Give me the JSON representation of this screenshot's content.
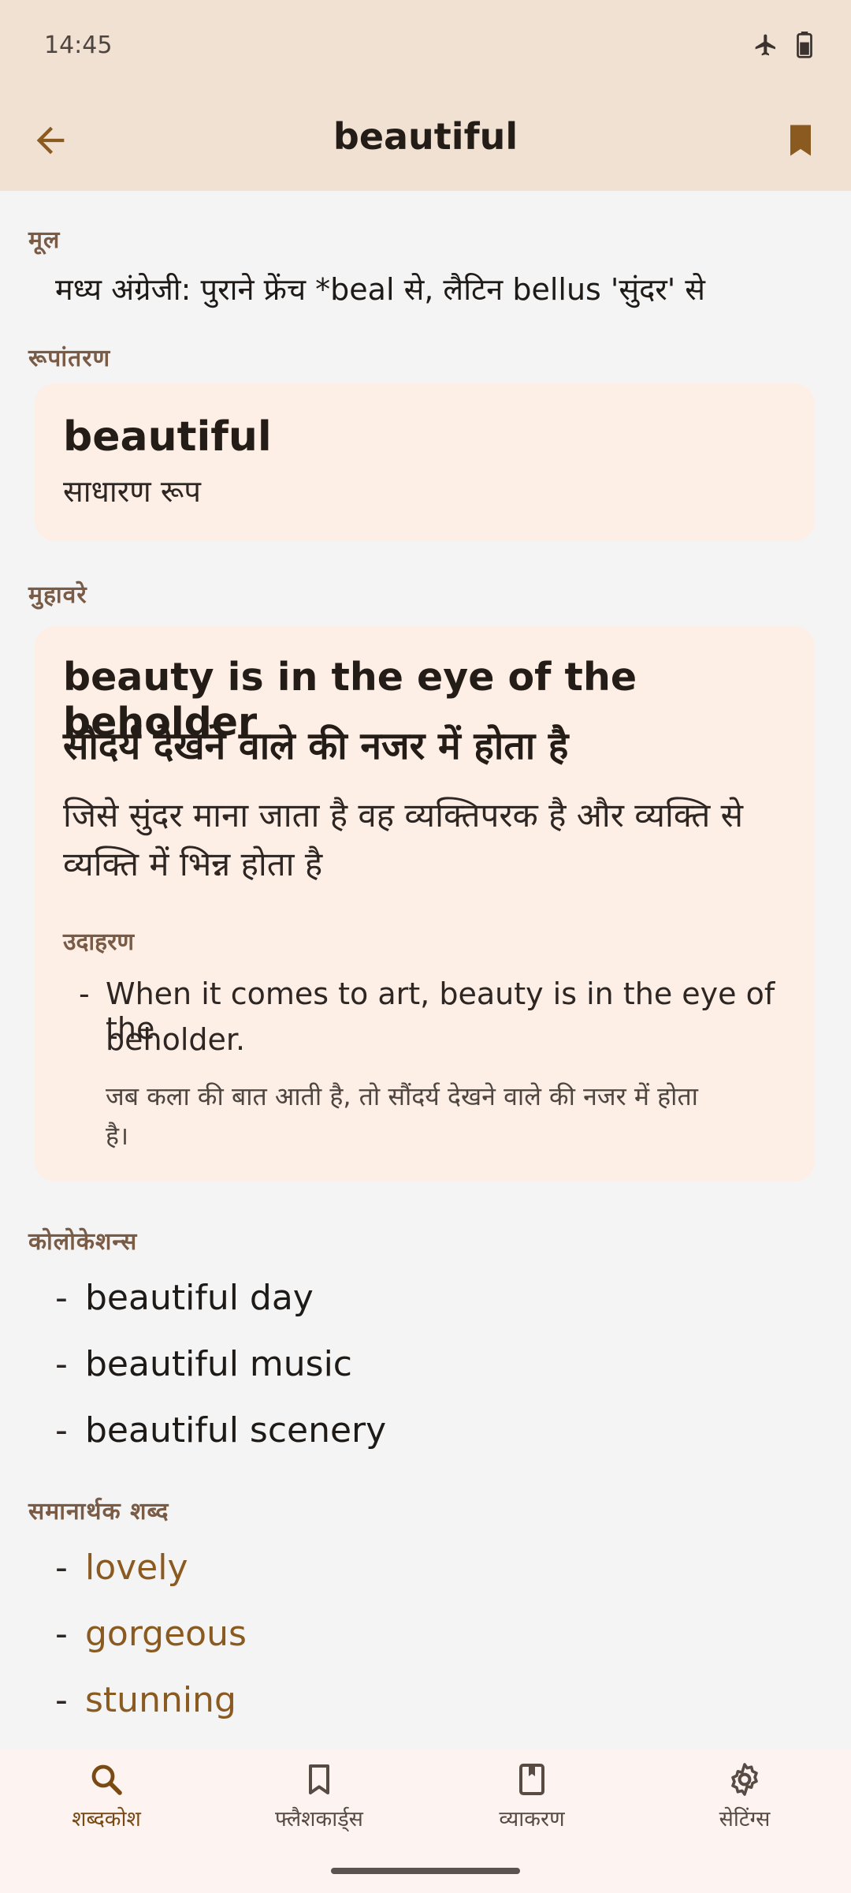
{
  "status": {
    "time": "14:45"
  },
  "appbar": {
    "title": "beautiful"
  },
  "origin": {
    "label": "मूल",
    "text": "मध्य अंग्रेजी: पुराने फ्रेंच *beal से, लैटिन bellus 'सुंदर' से"
  },
  "forms": {
    "label": "रूपांतरण",
    "word": "beautiful",
    "form_type": "साधारण रूप"
  },
  "idioms": {
    "label": "मुहावरे",
    "phrase": "beauty is in the eye of the beholder",
    "translation": "सौंदर्य देखने वाले की नजर में होता है",
    "meaning_line1": "जिसे सुंदर माना जाता है वह व्यक्तिपरक है और व्यक्ति से",
    "meaning_line2": "व्यक्ति में भिन्न होता है",
    "example_label": "उदाहरण",
    "example_en_line1": "When it comes to art, beauty is in the eye of the",
    "example_en_line2": "beholder.",
    "example_hi_line1": "जब कला की बात आती है, तो सौंदर्य देखने वाले की नजर में होता",
    "example_hi_line2": "है।"
  },
  "collocations": {
    "label": "कोलोकेशन्स",
    "items": [
      "beautiful day",
      "beautiful music",
      "beautiful scenery"
    ]
  },
  "synonyms": {
    "label": "समानार्थक शब्द",
    "items": [
      "lovely",
      "gorgeous",
      "stunning"
    ]
  },
  "nav": {
    "items": [
      {
        "label": "शब्दकोश",
        "icon": "search-icon"
      },
      {
        "label": "फ्लैशकार्ड्स",
        "icon": "bookmark-outline-icon"
      },
      {
        "label": "व्याकरण",
        "icon": "book-icon"
      },
      {
        "label": "सेटिंग्स",
        "icon": "gear-icon"
      }
    ]
  },
  "colors": {
    "accent": "#8a5a20",
    "appbar_bg": "#f1e1d3",
    "card_bg": "#fdeee6"
  }
}
